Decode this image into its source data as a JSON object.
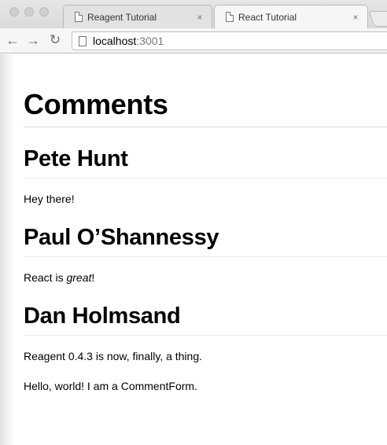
{
  "browser": {
    "tabs": [
      {
        "title": "Reagent Tutorial",
        "active": false
      },
      {
        "title": "React Tutorial",
        "active": true
      }
    ],
    "close_glyph": "×",
    "nav": {
      "back_icon": "←",
      "forward_icon": "→",
      "reload_icon": "↻"
    },
    "address": {
      "host": "localhost",
      "port": ":3001"
    }
  },
  "page": {
    "title": "Comments",
    "comments": [
      {
        "author": "Pete Hunt",
        "text": "Hey there!"
      },
      {
        "author": "Paul O’Shannessy",
        "text_before": "React is ",
        "text_em": "great",
        "text_after": "!"
      },
      {
        "author": "Dan Holmsand",
        "text": "Reagent 0.4.3 is now, finally, a thing."
      }
    ],
    "comment_form_text": "Hello, world! I am a CommentForm."
  }
}
